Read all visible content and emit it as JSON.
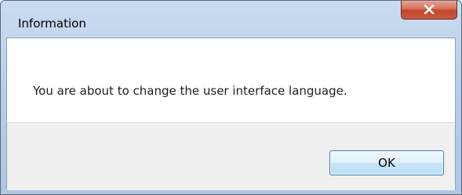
{
  "window": {
    "title": "Information",
    "close_icon": "close-icon"
  },
  "dialog": {
    "message": "You are about to change the user interface language.",
    "ok_label": "OK"
  },
  "colors": {
    "close_button": "#c95b40",
    "button_area": "#f0f0f0",
    "ok_border": "#3c7fb1"
  }
}
